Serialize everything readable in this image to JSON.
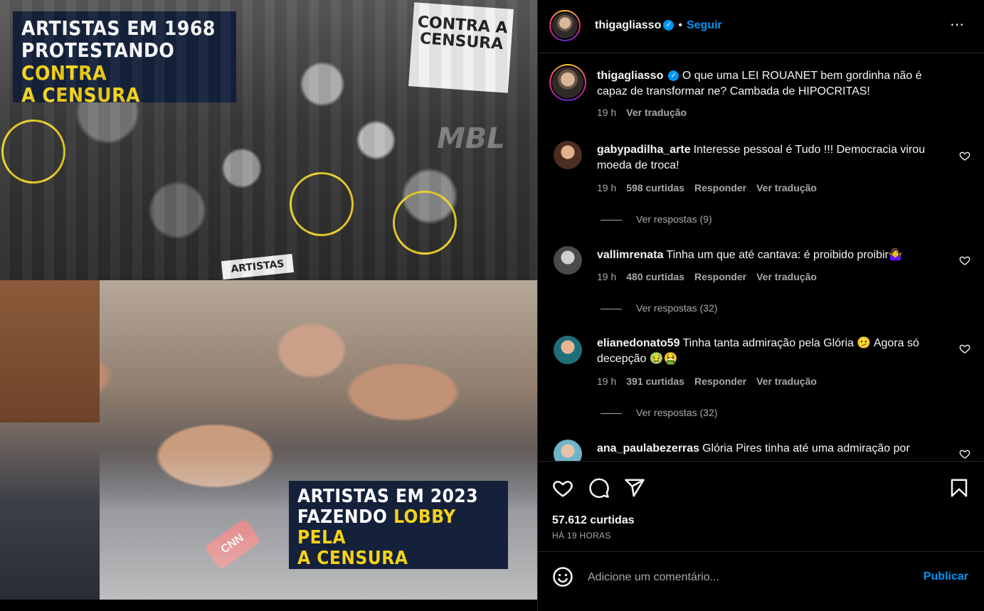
{
  "media": {
    "banner_top": {
      "line1": "ARTISTAS EM 1968",
      "line2_a": "PROTESTANDO ",
      "line2_b": "CONTRA",
      "line3": "A CENSURA"
    },
    "banner_bottom": {
      "line1": "ARTISTAS EM 2023",
      "line2_a": "FAZENDO ",
      "line2_b": "LOBBY PELA",
      "line3": "A CENSURA"
    },
    "sign_main": "CONTRA A CENSURA",
    "sign_small": "ARTISTAS",
    "watermark": "MBL",
    "mic_label": "CNN",
    "highlight_color": "#f3d21a",
    "circle_color": "#e8cf2a"
  },
  "header": {
    "username": "thigagliasso",
    "separator": "•",
    "follow_label": "Seguir",
    "more_icon": "⋯"
  },
  "caption": {
    "username": "thigagliasso",
    "text": "O que uma LEI ROUANET bem gordinha não é capaz de transformar ne? Cambada de HIPOCRITAS!",
    "time": "19 h",
    "translate": "Ver tradução"
  },
  "comments": [
    {
      "username": "gabypadilha_arte",
      "text": "Interesse pessoal é Tudo !!! Democracia virou moeda de troca!",
      "time": "19 h",
      "likes": "598 curtidas",
      "reply": "Responder",
      "translate": "Ver tradução",
      "replies": "Ver respostas (9)"
    },
    {
      "username": "vallimrenata",
      "text": "Tinha um que até cantava: é proibido proibir🤷‍♀️",
      "time": "19 h",
      "likes": "480 curtidas",
      "reply": "Responder",
      "translate": "Ver tradução",
      "replies": "Ver respostas (32)"
    },
    {
      "username": "elianedonato59",
      "text": "Tinha tanta admiração pela Glória 🫤 Agora só decepção 🤢🤮",
      "time": "19 h",
      "likes": "391 curtidas",
      "reply": "Responder",
      "translate": "Ver tradução",
      "replies": "Ver respostas (32)"
    },
    {
      "username": "ana_paulabezerras",
      "text": "Glória Pires tinha até uma admiração por"
    }
  ],
  "actions": {
    "likes": "57.612 curtidas",
    "time": "HÁ 19 HORAS",
    "icons": [
      "heart-icon",
      "comment-icon",
      "share-icon",
      "bookmark-icon"
    ]
  },
  "add_comment": {
    "placeholder": "Adicione um comentário...",
    "publish_label": "Publicar"
  },
  "colors": {
    "accent": "#0095f6",
    "muted": "#a8a8a8",
    "background": "#000000",
    "border": "#262626"
  }
}
